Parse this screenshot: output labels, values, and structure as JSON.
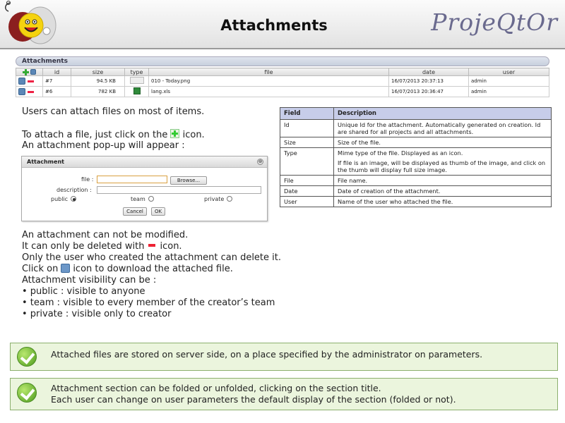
{
  "header": {
    "title": "Attachments",
    "brand": "ProjeQtOr"
  },
  "section": {
    "title": "Attachments",
    "columns": [
      "id",
      "size",
      "type",
      "file",
      "date",
      "user"
    ],
    "rows": [
      {
        "id": "#7",
        "size": "94.5 KB",
        "file": "010 - Today.png",
        "date": "16/07/2013 20:37:13",
        "user": "admin"
      },
      {
        "id": "#6",
        "size": "782 KB",
        "file": "lang.xls",
        "date": "16/07/2013 20:36:47",
        "user": "admin"
      }
    ]
  },
  "left": {
    "p1": "Users can attach files on most of items.",
    "p2a": "To attach a file, just click on the",
    "p2b": "icon.",
    "p3": "An attachment pop-up will appear :",
    "l1": "An attachment can not be modified.",
    "l2a": "It can only be deleted with",
    "l2b": "icon.",
    "l3": "Only the user who created the attachment can delete it.",
    "l4a": "Click on",
    "l4b": "icon to download the attached file.",
    "l5": "Attachment visibility can be :",
    "l6": "• public : visible to anyone",
    "l7": "• team : visible to every member of the creator’s team",
    "l8": "• private : visible only to creator"
  },
  "popup": {
    "title": "Attachment",
    "close": "⊗",
    "file_label": "file :",
    "browse": "Browse...",
    "description_label": "description :",
    "public": "public",
    "team": "team",
    "private": "private",
    "cancel": "Cancel",
    "ok": "OK"
  },
  "fields_table": {
    "head_field": "Field",
    "head_desc": "Description",
    "rows": [
      {
        "field": "Id",
        "desc": "Unique Id for the attachment. Automatically generated on creation. Id are shared for all projects and all attachments."
      },
      {
        "field": "Size",
        "desc": "Size of the file."
      },
      {
        "field": "Type",
        "desc": "Mime type of the file. Displayed as an icon.",
        "desc2": "If file is an image, will be displayed as thumb of the image, and click on the thumb will display full size image."
      },
      {
        "field": "File",
        "desc": "File name."
      },
      {
        "field": "Date",
        "desc": "Date of creation of the attachment."
      },
      {
        "field": "User",
        "desc": "Name of the user who attached the file."
      }
    ]
  },
  "info1": {
    "text": "Attached files are stored on server side, on a place specified by the administrator on parameters."
  },
  "info2": {
    "line1": "Attachment section can be folded or unfolded, clicking on the section title.",
    "line2": "Each user can change on user parameters the default display of the section (folded or not)."
  }
}
